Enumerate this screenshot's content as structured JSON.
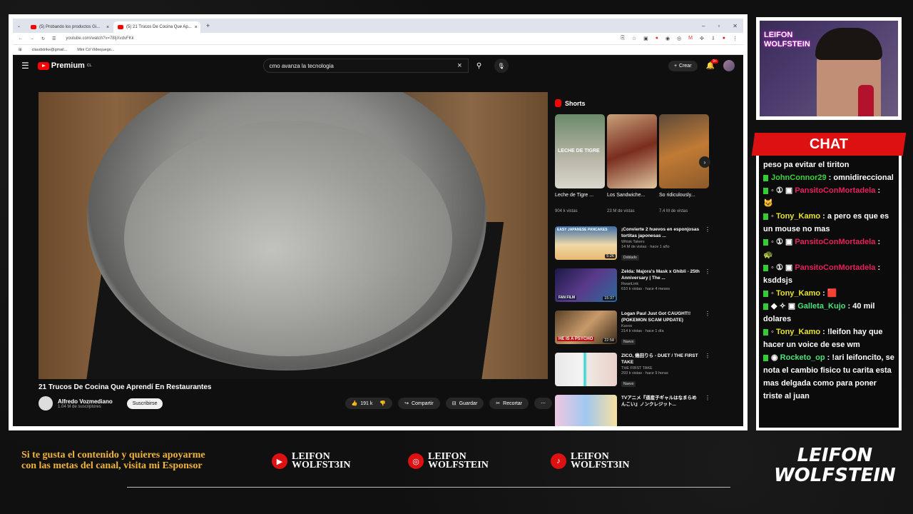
{
  "browser": {
    "tabs": [
      {
        "label": "(5) Probando los productos Gi..."
      },
      {
        "label": "(5) 21 Trucos De Cocina Que Ap..."
      }
    ],
    "url": "youtube.com/watch?v=78IjXvdvFKk",
    "bookmarks": [
      "claudstrike@gmail...",
      "Mini Cd Videojuego..."
    ]
  },
  "youtube": {
    "logo_text": "Premium",
    "logo_sup": "CL",
    "search_value": "cmo avanza la tecnologia",
    "create_label": "Crear",
    "notif_badge": "9+",
    "video_title": "21 Trucos De Cocina Que Aprendí En Restaurantes",
    "channel_name": "Alfredo Vozmediano",
    "channel_subs": "1.04 M de suscriptores",
    "subscribe_label": "Suscribirse",
    "likes": "191 k",
    "share_label": "Compartir",
    "save_label": "Guardar",
    "clip_label": "Recortar"
  },
  "sidebar": {
    "shorts_title": "Shorts",
    "shorts": [
      {
        "title": "Leche de Tigre ...",
        "views": "904 k vistas",
        "overlay": "LECHE DE TIGRE"
      },
      {
        "title": "Los Sandwiche...",
        "views": "23 M de vistas"
      },
      {
        "title": "So ridiculously...",
        "views": "7.4 M de vistas"
      }
    ],
    "recommended": [
      {
        "title": "¡Convierte 2 huevos en esponjosas tortitas japonesas ...",
        "channel": "Whisk Takers",
        "meta": "14 M de vistas · hace 1 año",
        "tag": "Doblado",
        "duration": "5:26",
        "thumb_text": "EASY JAPANESE PANCAKES"
      },
      {
        "title": "Zelda: Majora's Mask x Ghibli - 25th Anniversary | The ...",
        "channel": "RwanLink",
        "meta": "610 k vistas · hace 4 meses",
        "tag": "",
        "duration": "15:37",
        "thumb_text": "FAN FILM"
      },
      {
        "title": "Logan Paul Just Got CAUGHT!! (POKEMON SCAM UPDATE)",
        "channel": "Kavos",
        "meta": "214 k vistas · hace 1 día",
        "tag": "Nuevo",
        "duration": "22:58",
        "thumb_text": "HE IS A PSYCHO"
      },
      {
        "title": "ZICO, 幾田りら - DUET / THE FIRST TAKE",
        "channel": "THE FIRST TAKE",
        "meta": "293 k vistas · hace 9 horas",
        "tag": "Nuevo",
        "duration": "",
        "thumb_text": ""
      },
      {
        "title": "TVアニメ『道産子ギャルはなまらめんこい』ノンクレジット...",
        "channel": "",
        "meta": "",
        "tag": "",
        "duration": "",
        "thumb_text": ""
      }
    ]
  },
  "webcam": {
    "logo": "LEIFON WOLFSTEIN"
  },
  "chat": {
    "title": "CHAT",
    "messages": [
      {
        "user": "",
        "text": "peso pa evitar el tiriton",
        "color": "#ffffff"
      },
      {
        "user": "JohnConnor29",
        "text": "omnidireccional",
        "color": "#3fd23f"
      },
      {
        "user": "PansitoConMortadela",
        "text": "",
        "color": "#e6205d"
      },
      {
        "user": "Tony_Kamo",
        "text": "a pero es que es un mouse no mas",
        "color": "#e8e232"
      },
      {
        "user": "PansitoConMortadela",
        "text": "",
        "color": "#e6205d"
      },
      {
        "user": "PansitoConMortadela",
        "text": "ksddsjs",
        "color": "#e6205d"
      },
      {
        "user": "Tony_Kamo",
        "text": "",
        "color": "#e8e232"
      },
      {
        "user": "Galleta_Kujo",
        "text": "40 mil dolares",
        "color": "#4ee07a"
      },
      {
        "user": "Tony_Kamo",
        "text": "!leifon hay que hacer un voice de ese wm",
        "color": "#e8e232"
      },
      {
        "user": "Rocketo_op",
        "text": "!ari leifoncito, se nota el cambio fisico tu carita esta mas delgada como para poner triste al juan",
        "color": "#4ee07a"
      }
    ]
  },
  "footer": {
    "sponsor_text": "Si te gusta el contenido y quieres apoyarme con las metas del canal, visita mi Esponsor",
    "socials": [
      {
        "icon": "youtube-icon",
        "line1": "LEIFON",
        "line2": "WOLFST3IN"
      },
      {
        "icon": "instagram-icon",
        "line1": "LEIFON",
        "line2": "WOLFSTEIN"
      },
      {
        "icon": "tiktok-icon",
        "line1": "LEIFON",
        "line2": "WOLFST3IN"
      }
    ],
    "logo_line1": "LEIFON",
    "logo_line2": "WOLFSTEIN"
  }
}
